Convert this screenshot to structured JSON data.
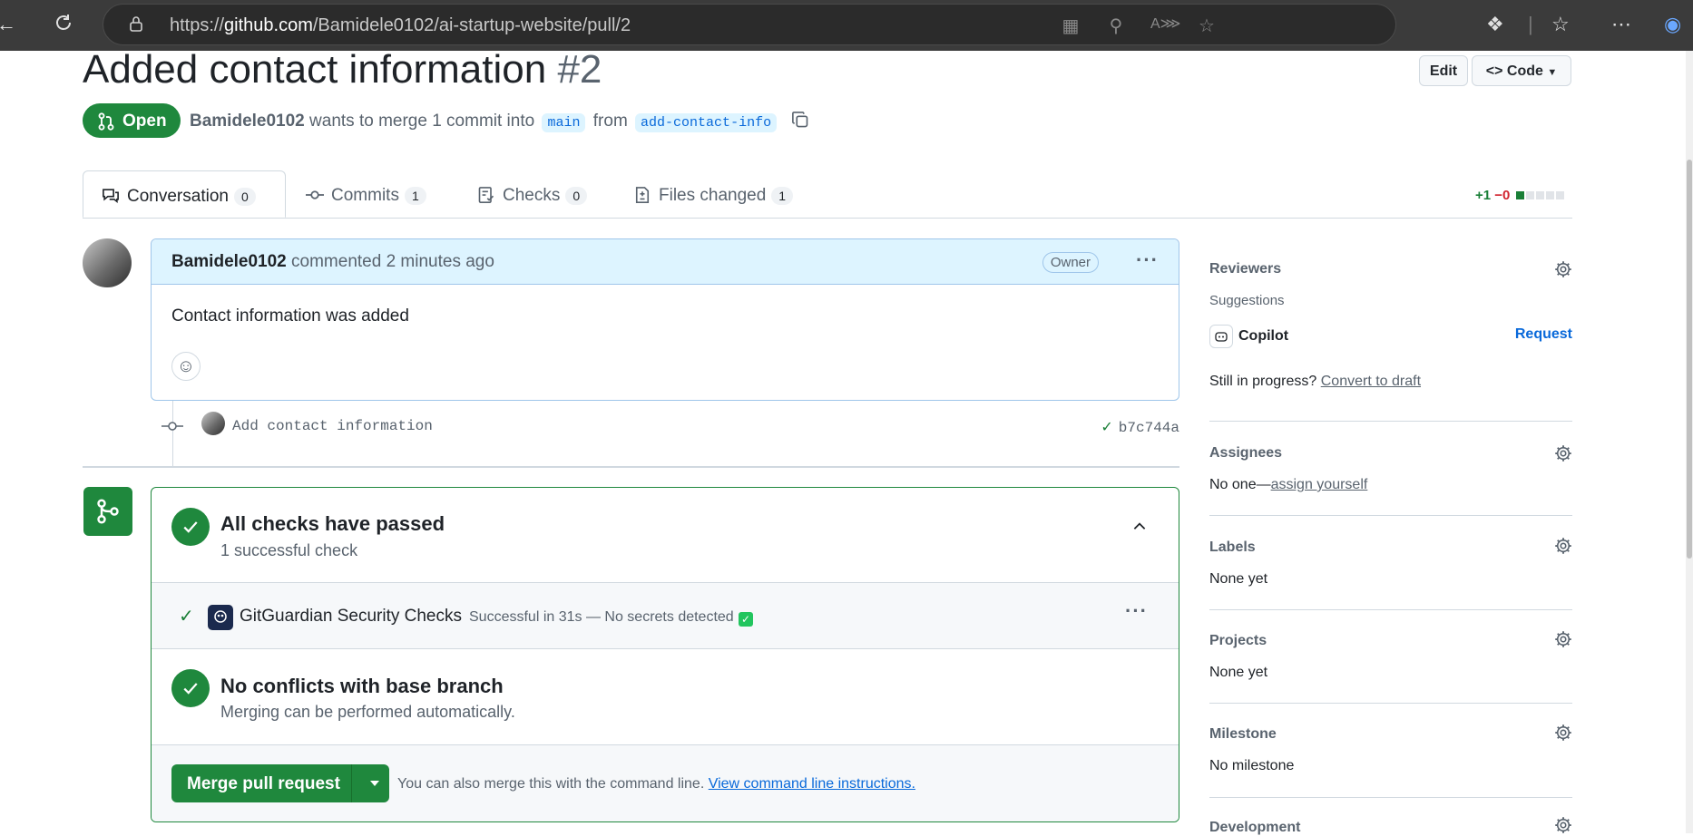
{
  "browser": {
    "url_prefix": "https://",
    "url_domain": "github.com",
    "url_path": "/Bamidele0102/ai-startup-website/pull/2"
  },
  "pr": {
    "title": "Added contact information",
    "number": "#2",
    "state": "Open",
    "author": "Bamidele0102",
    "meta_text": "wants to merge 1 commit into",
    "base_branch": "main",
    "from_text": "from",
    "head_branch": "add-contact-info",
    "edit_label": "Edit",
    "code_label": "Code"
  },
  "tabs": [
    {
      "label": "Conversation",
      "count": "0"
    },
    {
      "label": "Commits",
      "count": "1"
    },
    {
      "label": "Checks",
      "count": "0"
    },
    {
      "label": "Files changed",
      "count": "1"
    }
  ],
  "diffstat": {
    "additions": "+1",
    "deletions": "−0"
  },
  "comment": {
    "author": "Bamidele0102",
    "action": "commented 2 minutes ago",
    "badge": "Owner",
    "body": "Contact information was added"
  },
  "commit": {
    "message": "Add contact information",
    "sha": "b7c744a"
  },
  "merge": {
    "checks_title": "All checks have passed",
    "checks_sub": "1 successful check",
    "check_name": "GitGuardian Security Checks",
    "check_desc": "Successful in 31s — No secrets detected",
    "conflicts_title": "No conflicts with base branch",
    "conflicts_sub": "Merging can be performed automatically.",
    "merge_button": "Merge pull request",
    "hint_text": "You can also merge this with the command line.",
    "hint_link": "View command line instructions."
  },
  "sidebar": {
    "reviewers": "Reviewers",
    "suggestions": "Suggestions",
    "copilot": "Copilot",
    "request": "Request",
    "still_in_progress": "Still in progress?",
    "convert_to_draft": "Convert to draft",
    "assignees": "Assignees",
    "assignees_none": "No one—",
    "assign_yourself": "assign yourself",
    "labels": "Labels",
    "labels_value": "None yet",
    "projects": "Projects",
    "projects_value": "None yet",
    "milestone": "Milestone",
    "milestone_value": "No milestone",
    "development": "Development"
  },
  "colors": {
    "accent_green": "#1f883d",
    "link_blue": "#0969da"
  }
}
